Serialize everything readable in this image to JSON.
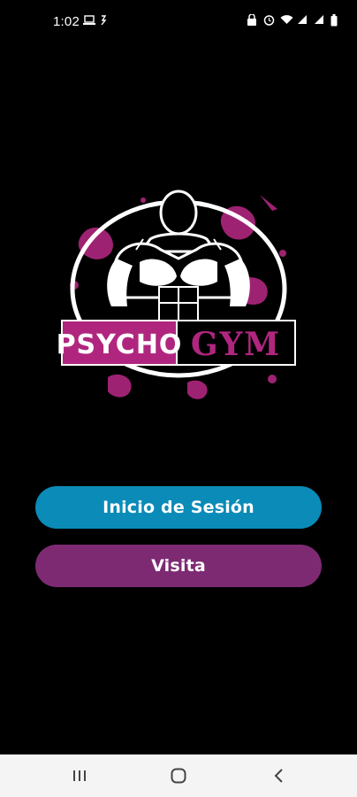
{
  "status_bar": {
    "time": "1:02",
    "left_icons": [
      "laptop-icon",
      "nfc-icon"
    ],
    "right_icons": [
      "lock-icon",
      "alarm-icon",
      "wifi-icon",
      "signal-icon",
      "signal-icon",
      "battery-icon"
    ]
  },
  "logo": {
    "word_left": "PSYCHO",
    "word_right": "GYM",
    "accent_color": "#b0267f"
  },
  "actions": {
    "login_label": "Inicio de Sesión",
    "visit_label": "Visita",
    "login_color": "#0a8bb8",
    "visit_color": "#7d2a73"
  },
  "nav_bar": {
    "items": [
      "recent-apps-icon",
      "home-icon",
      "back-icon"
    ]
  }
}
